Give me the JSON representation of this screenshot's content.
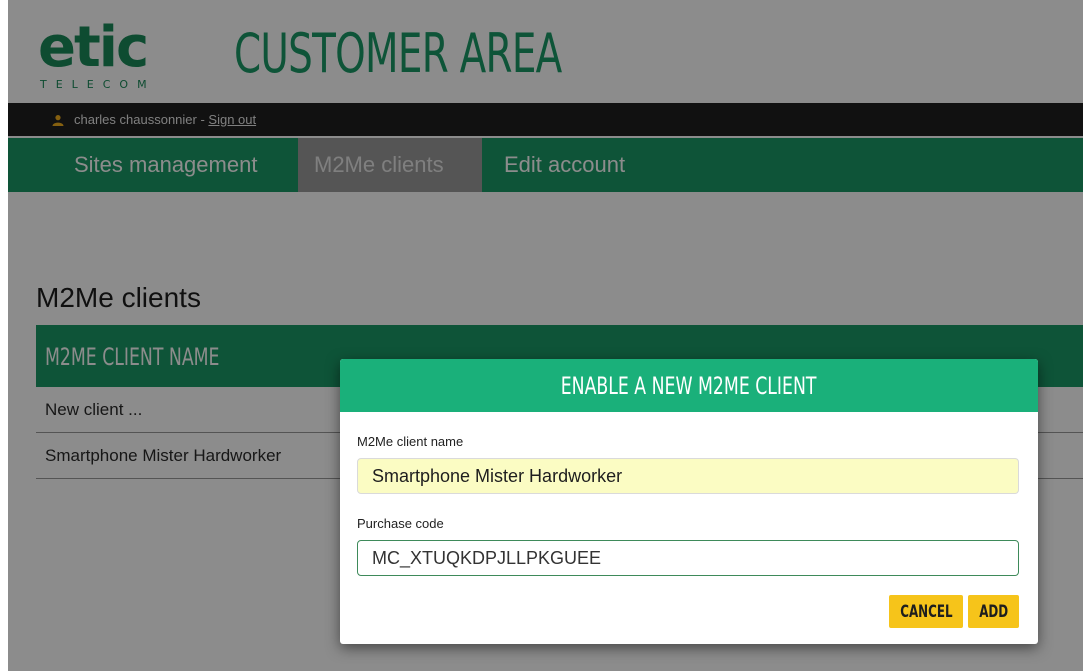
{
  "brand": {
    "logo_text": "etic",
    "logo_sub": "TELECOM",
    "area_title": "CUSTOMER AREA"
  },
  "user": {
    "name": "charles chaussonnier - ",
    "sign_out": "Sign out"
  },
  "nav": {
    "items": [
      "Sites management",
      "M2Me clients",
      "Edit account"
    ],
    "active_index": 1
  },
  "content": {
    "title": "M2Me clients",
    "table": {
      "header": "M2ME CLIENT NAME",
      "rows": [
        "New client ...",
        "Smartphone Mister Hardworker"
      ]
    }
  },
  "modal": {
    "title": "ENABLE A NEW M2ME CLIENT",
    "name_label": "M2Me client name",
    "name_value": "Smartphone Mister Hardworker",
    "code_label": "Purchase code",
    "code_value": "MC_XTUQKDPJLLPKGUEE",
    "cancel_label": "CANCEL",
    "add_label": "ADD"
  },
  "colors": {
    "brand_green": "#1a9a66",
    "modal_green": "#1ab07a",
    "button_yellow": "#f6c41a",
    "input_highlight": "#fbfcc3"
  }
}
